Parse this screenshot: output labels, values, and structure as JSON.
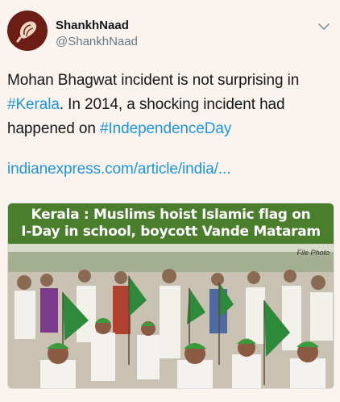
{
  "account": {
    "name": "ShankhNaad",
    "handle": "@ShankhNaad",
    "avatar_icon": "conch-shell-icon",
    "avatar_color": "#6b1d16"
  },
  "menu_icon": "chevron-down-icon",
  "tweet": {
    "text_part1": "Mohan Bhagwat incident is not surprising in ",
    "hashtag1": "#Kerala",
    "text_part2": ". In 2014, a shocking incident had happened on ",
    "hashtag2": "#IndependenceDay",
    "url": "indianexpress.com/article/india/...",
    "link_color": "#1b95e0"
  },
  "media": {
    "headline_line1": "Kerala : Muslims hoist Islamic flag on",
    "headline_line2": "I-Day in school, boycott Vande Mataram",
    "photo_credit": "File Photo",
    "headline_bg": "#4a7d2c"
  }
}
